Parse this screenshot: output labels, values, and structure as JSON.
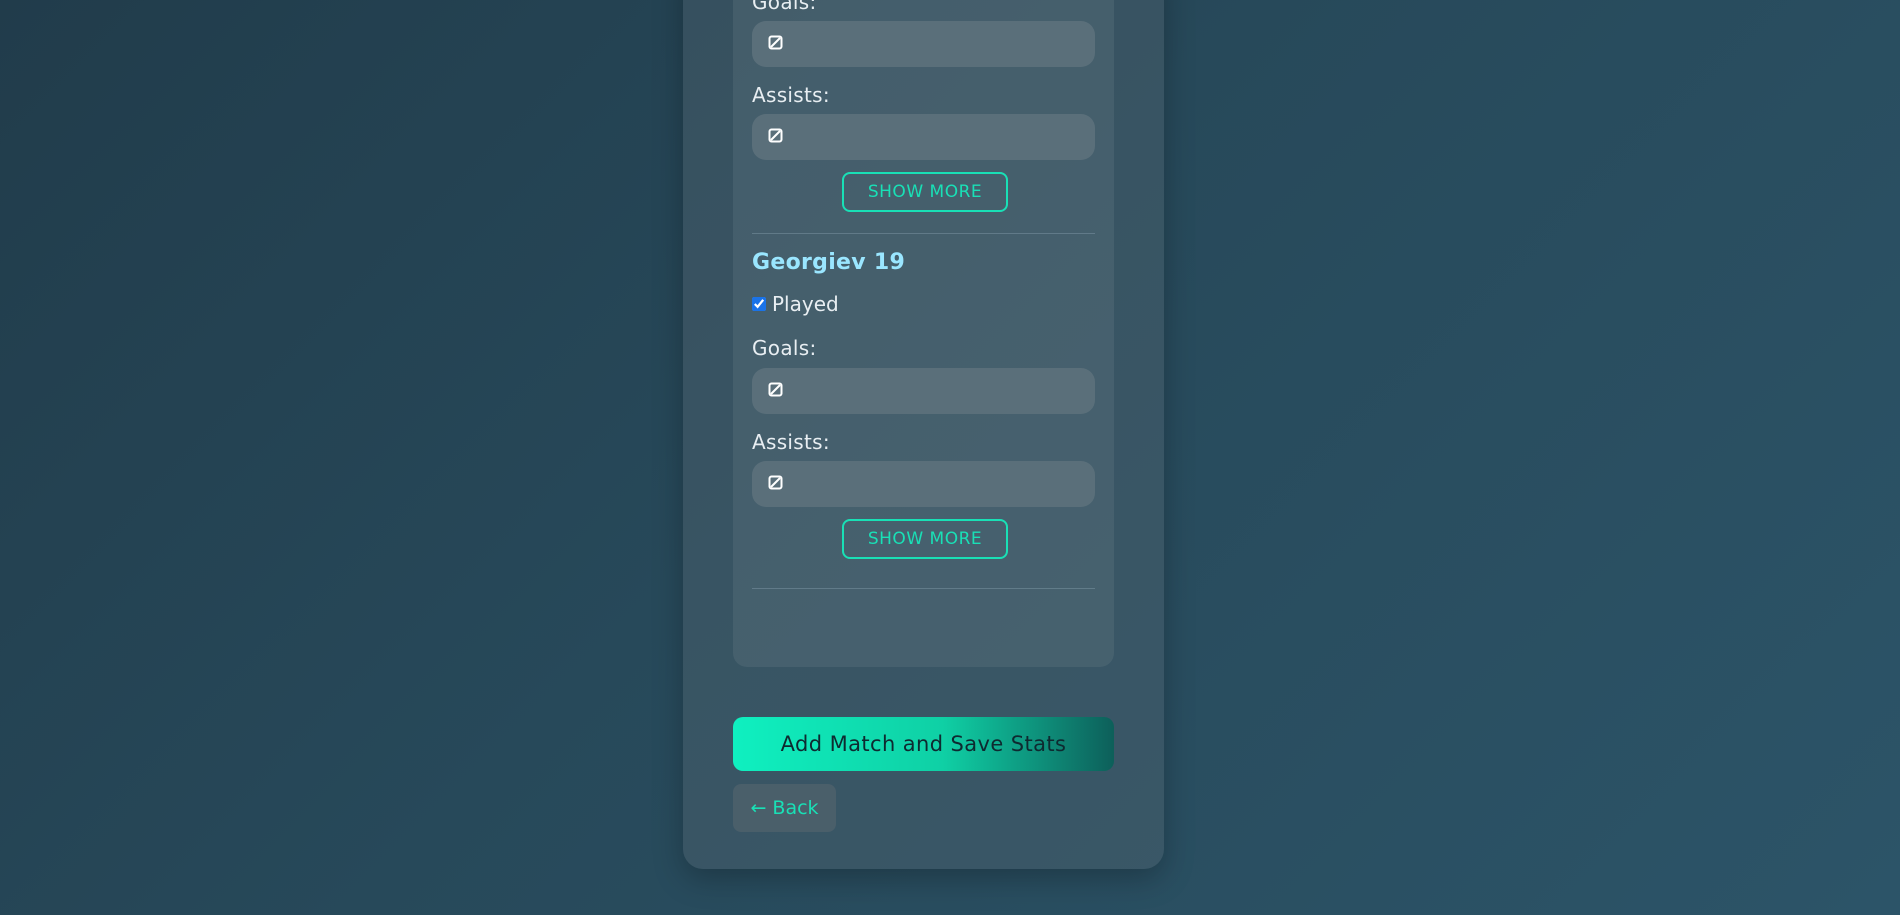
{
  "players": [
    {
      "name": "",
      "goals_label": "Goals:",
      "assists_label": "Assists:",
      "goals_value": "",
      "assists_value": "",
      "show_more_label": "SHOW MORE"
    },
    {
      "name": "Georgiev 19",
      "played_label": "Played",
      "played_checked": true,
      "goals_label": "Goals:",
      "assists_label": "Assists:",
      "goals_value": "",
      "assists_value": "",
      "show_more_label": "SHOW MORE"
    }
  ],
  "actions": {
    "submit_label": "Add Match and Save Stats",
    "back_label": "← Back"
  },
  "colors": {
    "accent": "#19e0b6",
    "player_name": "#9ae6ff",
    "input_bg": "#5a6f7a",
    "checkbox": "#1a73e8"
  },
  "icons": {
    "input_icon": "no-entry-square-icon"
  }
}
